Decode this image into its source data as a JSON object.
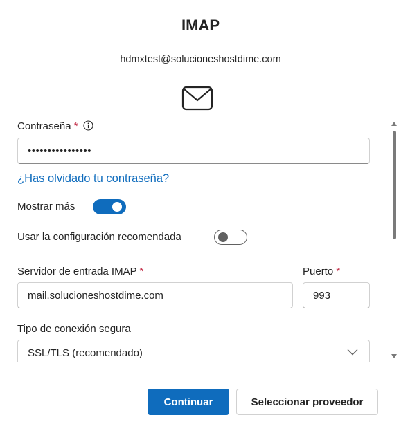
{
  "header": {
    "title": "IMAP",
    "email": "hdmxtest@solucioneshostdime.com"
  },
  "form": {
    "password_label": "Contraseña",
    "required_mark": "*",
    "password_value": "••••••••••••••••",
    "forgot_link": "¿Has olvidado tu contraseña?",
    "show_more_label": "Mostrar más",
    "show_more_on": true,
    "recommended_label": "Usar la configuración recomendada",
    "recommended_on": false,
    "server_label": "Servidor de entrada IMAP",
    "server_value": "mail.solucioneshostdime.com",
    "port_label": "Puerto",
    "port_value": "993",
    "connection_label": "Tipo de conexión segura",
    "connection_value": "SSL/TLS (recomendado)"
  },
  "footer": {
    "continue_label": "Continuar",
    "provider_label": "Seleccionar proveedor"
  },
  "colors": {
    "accent": "#0f6cbd",
    "required": "#c4314b",
    "text": "#242424"
  }
}
